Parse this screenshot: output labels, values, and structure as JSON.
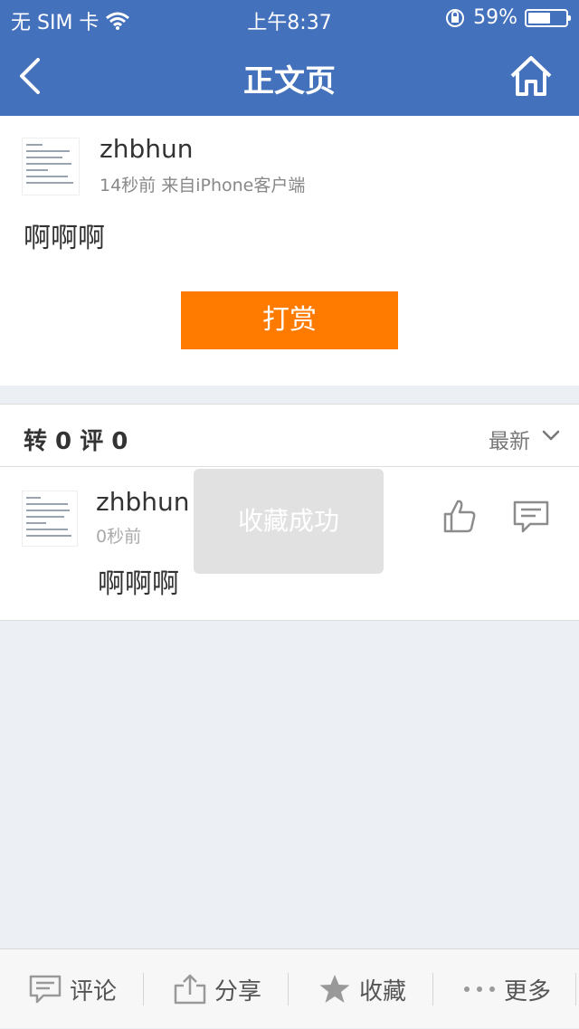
{
  "status_bar": {
    "carrier": "无 SIM 卡",
    "time": "上午8:37",
    "battery_percent": "59%",
    "battery_level": 0.59
  },
  "nav": {
    "title": "正文页"
  },
  "post": {
    "author": "zhbhun",
    "meta": "14秒前  来自iPhone客户端",
    "content": "啊啊啊",
    "tip_label": "打赏"
  },
  "counts": {
    "text": "转 0  评 0",
    "sort_label": "最新"
  },
  "comment": {
    "author": "zhbhun",
    "time": "0秒前",
    "content": "啊啊啊"
  },
  "toast": {
    "text": "收藏成功"
  },
  "bottom_bar": {
    "items": [
      {
        "label": "评论",
        "icon": "comment-icon"
      },
      {
        "label": "分享",
        "icon": "share-icon"
      },
      {
        "label": "收藏",
        "icon": "star-icon"
      },
      {
        "label": "更多",
        "icon": "more-icon"
      }
    ]
  },
  "colors": {
    "brand": "#4471bc",
    "tip_button": "#ff7b00",
    "background": "#eceff4"
  }
}
